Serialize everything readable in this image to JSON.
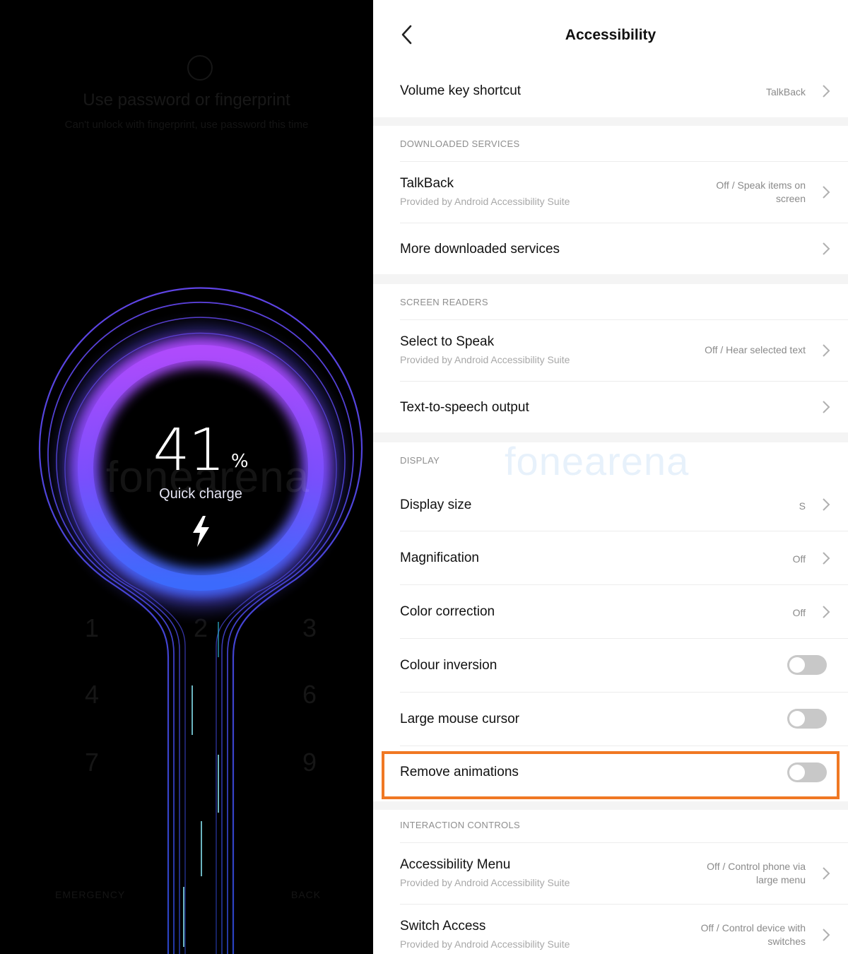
{
  "lock_screen": {
    "ghost_title": "Use password or fingerprint",
    "ghost_subtitle": "Can't unlock with fingerprint, use password this time",
    "ghost_keys": [
      "1",
      "2",
      "3",
      "4",
      "6",
      "7",
      "9"
    ],
    "ghost_emergency": "EMERGENCY",
    "ghost_back": "BACK",
    "battery_percent_value": "41",
    "battery_percent_sign": "%",
    "charge_mode": "Quick charge",
    "bolt_icon": "lightning-bolt-icon",
    "ring_colors": [
      "#9b3cff",
      "#5a4bff",
      "#3b6bff"
    ],
    "watermark": "fonearena"
  },
  "header": {
    "back_icon": "chevron-left-icon",
    "title": "Accessibility"
  },
  "volume_key": {
    "label": "Volume key shortcut",
    "value": "TalkBack"
  },
  "downloaded_services": {
    "heading": "DOWNLOADED SERVICES",
    "talkback": {
      "label": "TalkBack",
      "sub": "Provided by Android Accessibility Suite",
      "value_line1": "Off / Speak items on",
      "value_line2": "screen"
    },
    "more": {
      "label": "More downloaded services"
    }
  },
  "screen_readers": {
    "heading": "SCREEN READERS",
    "select_to_speak": {
      "label": "Select to Speak",
      "sub": "Provided by Android Accessibility Suite",
      "value": "Off / Hear selected text"
    },
    "tts": {
      "label": "Text-to-speech output"
    }
  },
  "display": {
    "heading": "DISPLAY",
    "display_size": {
      "label": "Display size",
      "value": "S"
    },
    "magnification": {
      "label": "Magnification",
      "value": "Off"
    },
    "color_correction": {
      "label": "Color correction",
      "value": "Off"
    },
    "colour_inversion": {
      "label": "Colour inversion",
      "on": false
    },
    "large_mouse_cursor": {
      "label": "Large mouse cursor",
      "on": false
    },
    "remove_animations": {
      "label": "Remove animations",
      "on": false
    }
  },
  "interaction_controls": {
    "heading": "INTERACTION CONTROLS",
    "accessibility_menu": {
      "label": "Accessibility Menu",
      "sub": "Provided by Android Accessibility Suite",
      "value_line1": "Off / Control phone via",
      "value_line2": "large menu"
    },
    "switch_access": {
      "label": "Switch Access",
      "sub": "Provided by Android Accessibility Suite",
      "value_line1": "Off / Control device with",
      "value_line2": "switches"
    }
  },
  "watermark": "fonearena",
  "colors": {
    "highlight": "#f07823",
    "toggle_off": "#c8c8c8",
    "panel_bg": "#f4f4f4"
  }
}
